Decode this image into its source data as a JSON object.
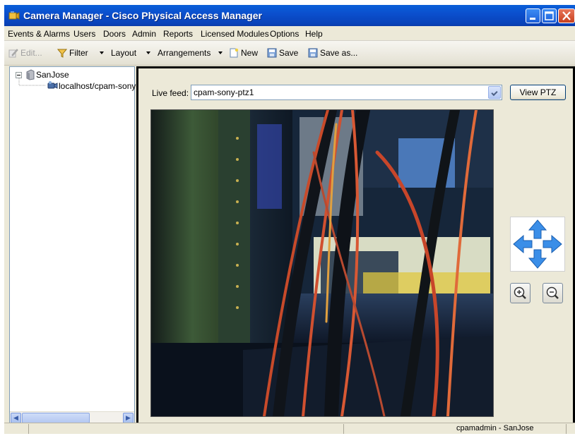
{
  "window": {
    "title": "Camera Manager - Cisco Physical Access Manager"
  },
  "menu": {
    "items": [
      "Events & Alarms",
      "Users",
      "Doors",
      "Admin",
      "Reports",
      "Licensed Modules",
      "Options",
      "Help"
    ]
  },
  "toolbar": {
    "edit_label": "Edit...",
    "filter_label": "Filter",
    "layout_label": "Layout",
    "arrangements_label": "Arrangements",
    "new_label": "New",
    "save_label": "Save",
    "saveas_label": "Save as..."
  },
  "tree": {
    "root_label": "SanJose",
    "child_label": "localhost/cpam-sony-p"
  },
  "feed": {
    "label": "Live feed:",
    "selected": "cpam-sony-ptz1",
    "view_ptz_label": "View PTZ"
  },
  "status": {
    "user_site": "cpamadmin - SanJose"
  },
  "colors": {
    "titlebar": "#0b4fce",
    "window_face": "#ece9d8",
    "ptz_arrow": "#3a8ee8"
  }
}
